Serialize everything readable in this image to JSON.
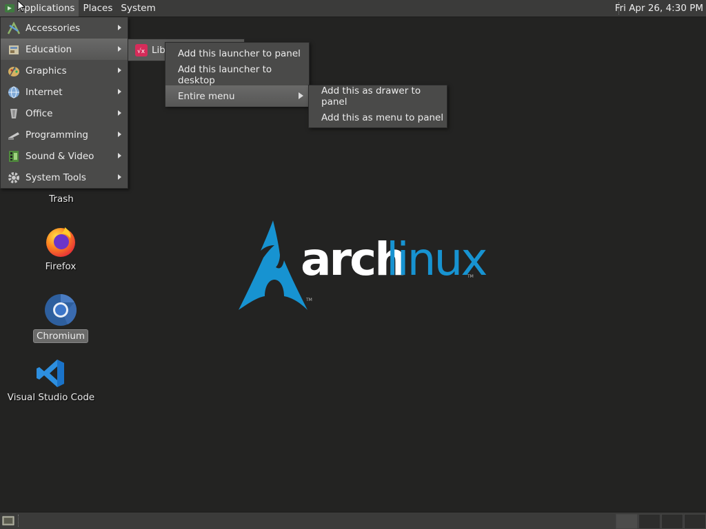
{
  "top_panel": {
    "menus": [
      "Applications",
      "Places",
      "System"
    ],
    "clock": "Fri Apr 26,  4:30 PM"
  },
  "applications_menu": {
    "items": [
      {
        "label": "Accessories",
        "icon": "accessories-icon"
      },
      {
        "label": "Education",
        "icon": "education-icon"
      },
      {
        "label": "Graphics",
        "icon": "graphics-icon"
      },
      {
        "label": "Internet",
        "icon": "internet-icon"
      },
      {
        "label": "Office",
        "icon": "office-icon"
      },
      {
        "label": "Programming",
        "icon": "programming-icon"
      },
      {
        "label": "Sound & Video",
        "icon": "sound-video-icon"
      },
      {
        "label": "System Tools",
        "icon": "system-tools-icon"
      }
    ]
  },
  "education_menu": {
    "items": [
      {
        "label": "Libr",
        "icon": "libreoffice-math-icon"
      }
    ]
  },
  "context_menu": {
    "items": [
      "Add this launcher to panel",
      "Add this launcher to desktop",
      "Entire menu"
    ]
  },
  "entire_menu_submenu": {
    "items": [
      "Add this as drawer to panel",
      "Add this as menu to panel"
    ]
  },
  "desktop_icons": [
    {
      "label": "Trash",
      "icon": "trash-icon"
    },
    {
      "label": "Firefox",
      "icon": "firefox-icon"
    },
    {
      "label": "Chromium",
      "icon": "chromium-icon"
    },
    {
      "label": "Visual Studio Code",
      "icon": "vscode-icon"
    }
  ],
  "wallpaper": {
    "logo_text_1": "arch",
    "logo_text_2": "linux",
    "trademark": "TM",
    "colors": {
      "arch_blue": "#1793d1",
      "background": "#232322"
    }
  }
}
